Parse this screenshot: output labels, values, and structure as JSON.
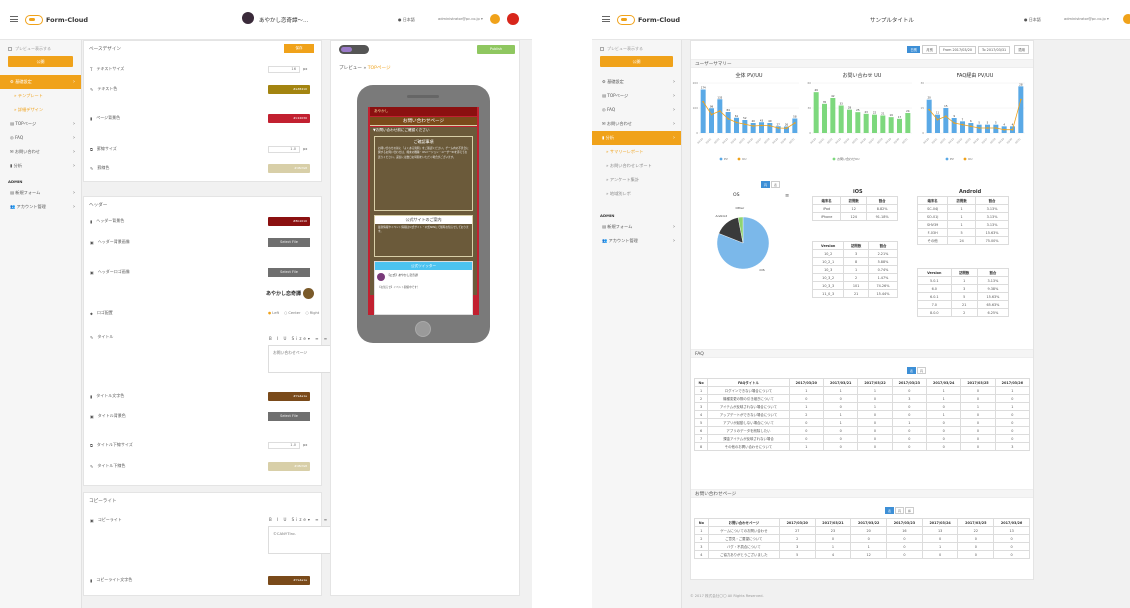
{
  "left": {
    "app_name": "Form-Cloud",
    "page_title": "あやかし恋奇譚〜…",
    "user_email": "administrator@pc.co.jp",
    "lang": "日本語",
    "sidebar": {
      "preview_label": "プレビュー表示する",
      "save_label": "公開",
      "items": [
        {
          "label": "基礎設定",
          "active": true
        },
        {
          "label": "テンプレート",
          "sub": true
        },
        {
          "label": "詳細デザイン",
          "sub": true,
          "current": true
        },
        {
          "label": "TOPページ"
        },
        {
          "label": "FAQ"
        },
        {
          "label": "お問い合わせ"
        },
        {
          "label": "分析"
        }
      ],
      "admin_heading": "ADMIN",
      "admin_items": [
        {
          "label": "新規フォーム"
        },
        {
          "label": "アカウント管理"
        }
      ]
    },
    "base_design": {
      "title": "ベースデザイン",
      "save_label": "保存",
      "fields": [
        {
          "label": "テキストサイズ",
          "value": "16",
          "unit": "px"
        },
        {
          "label": "テキスト色",
          "color": "#a38410",
          "hex": "#a38410"
        },
        {
          "label": "ページ背景色",
          "color": "#c22030",
          "hex": "#c22030"
        },
        {
          "label": "罫線サイズ",
          "value": "1.0",
          "unit": "px"
        },
        {
          "label": "罫線色",
          "color": "#d8cfa8",
          "hex": "#d8cfa8"
        }
      ]
    },
    "header": {
      "title": "ヘッダー",
      "bg_color_label": "ヘッダー背景色",
      "bg_color": "#8b1010",
      "bg_color_hex": "#8b1010",
      "bg_image_label": "ヘッダー背景画像",
      "bg_image_btn": "Select File",
      "logo_label": "ヘッダーロゴ画像",
      "logo_btn": "Select File",
      "logo_text": "あやかし恋奇譚",
      "align_label": "ロゴ配置",
      "align_opts": [
        "Left",
        "Center",
        "Right"
      ],
      "title_label": "タイトル",
      "title_value": "お問い合わせページ",
      "toolbar": "B  I  U  Size▾  ≡  ≡  ≡",
      "title_color_label": "タイトル文字色",
      "title_color": "#7a4a1a",
      "title_color_hex": "#7a4a1a",
      "title_bg_label": "タイトル背景色",
      "title_bg_btn": "Select File",
      "title_border_size_label": "タイトル下線サイズ",
      "title_border_size": "1.0",
      "title_border_color_label": "タイトル下線色",
      "title_border_color": "#d8cfa8",
      "title_border_color_hex": "#d8cfa8"
    },
    "copyright": {
      "title": "コピーライト",
      "label": "コピーライト",
      "value": "©CANYTInc.",
      "color_label": "コピーライト文字色",
      "color": "#7a4a1a",
      "color_hex": "#7a4a1a"
    },
    "preview": {
      "breadcrumb_root": "プレビュー",
      "breadcrumb_sep": "»",
      "breadcrumb_page": "TOPページ",
      "publish_btn": "Publish",
      "header_text": "あやかし",
      "page_title": "お問い合わせページ",
      "notice_heading": "▼お問い合わせ前にご確認ください",
      "box1_title": "ご確認事項",
      "box1_text": "お問い合わせの前に「よくある質問」をご確認ください。ゲーム内の不具合に関するお問い合わせは、端末の機種・OSバージョン・ユーザーIDを添えてお送りください。返信には数日お時間をいただく場合がございます。",
      "box2_title": "公式サイトのご案内",
      "box2_text": "最新情報やイベント情報は公式サイト・公式SNSにて随時お知らせしております。",
      "twitter_title": "公式ツイッター",
      "tweet_author": "【公式】あやかし恋奇譚",
      "tweet_text": "【お知らせ】イベント開催中です！"
    }
  },
  "right": {
    "app_name": "Form-Cloud",
    "page_title": "サンプルタイトル",
    "lang": "日本語",
    "user_email": "administrator@pc.co.jp",
    "sidebar": {
      "preview_label": "プレビュー表示する",
      "save_label": "公開",
      "items": [
        {
          "label": "基礎設定"
        },
        {
          "label": "TOPページ"
        },
        {
          "label": "FAQ"
        },
        {
          "label": "お問い合わせ"
        },
        {
          "label": "分析",
          "active": true
        },
        {
          "label": "サマリーレポート",
          "sub": true,
          "current": true
        },
        {
          "label": "お問い合わせレポート",
          "sub": true
        },
        {
          "label": "アンケート集計",
          "sub": true
        },
        {
          "label": "地域別レポ",
          "sub": true
        }
      ],
      "admin_heading": "ADMIN",
      "admin_items": [
        {
          "label": "新規フォーム"
        },
        {
          "label": "アカウント管理"
        }
      ]
    },
    "filter": {
      "tabs": [
        "日別",
        "月別"
      ],
      "from_label": "From",
      "from_value": "2017/03/20",
      "to_label": "To",
      "to_value": "2017/03/31",
      "apply": "適用"
    },
    "summary_title": "ユーザーサマリー",
    "charts": [
      {
        "title": "全体 PV/UU",
        "legend": [
          "PV",
          "UU"
        ],
        "bar_color": "#5aa9e6",
        "line_color": "#f0a21a"
      },
      {
        "title": "お問い合わせ UU",
        "legend": [
          "お問い合わせUU"
        ],
        "bar_color": "#7dd87d"
      },
      {
        "title": "FAQ経由 PV/UU",
        "legend": [
          "PV",
          "UU"
        ],
        "bar_color": "#5aa9e6",
        "line_color": "#f0a21a"
      }
    ],
    "chart_data": [
      {
        "type": "bar",
        "title": "全体 PV/UU",
        "categories": [
          "03/20",
          "03/21",
          "03/22",
          "03/23",
          "03/24",
          "03/25",
          "03/26",
          "03/27",
          "03/28",
          "03/29",
          "03/30",
          "03/31"
        ],
        "series": [
          {
            "name": "PV",
            "values": [
              174,
              99,
              135,
              84,
              61,
              52,
              40,
              43,
              40,
              27,
              26,
              58
            ]
          },
          {
            "name": "UU",
            "values": [
              125,
              74,
              88,
              57,
              42,
              35,
              28,
              30,
              29,
              20,
              19,
              40
            ]
          }
        ],
        "ylim": [
          0,
          200
        ]
      },
      {
        "type": "bar",
        "title": "お問い合わせ UU",
        "categories": [
          "03/20",
          "03/21",
          "03/22",
          "03/23",
          "03/24",
          "03/25",
          "03/26",
          "03/27",
          "03/28",
          "03/29",
          "03/30",
          "03/31"
        ],
        "series": [
          {
            "name": "お問い合わせUU",
            "values": [
              49,
              35,
              42,
              33,
              28,
              25,
              23,
              22,
              21,
              19,
              17,
              24
            ]
          }
        ],
        "ylim": [
          0,
          60
        ]
      },
      {
        "type": "bar",
        "title": "FAQ経由 PV/UU",
        "categories": [
          "03/20",
          "03/21",
          "03/22",
          "03/23",
          "03/24",
          "03/25",
          "03/26",
          "03/27",
          "03/28",
          "03/29",
          "03/30",
          "03/31"
        ],
        "series": [
          {
            "name": "PV",
            "values": [
              20,
              11,
              15,
              9,
              7,
              6,
              5,
              5,
              5,
              4,
              4,
              28
            ]
          },
          {
            "name": "UU",
            "values": [
              14,
              8,
              10,
              6,
              5,
              4,
              3,
              3,
              3,
              2,
              2,
              20
            ]
          }
        ],
        "ylim": [
          0,
          30
        ]
      },
      {
        "type": "pie",
        "title": "OS",
        "categories": [
          "iOS",
          "Android",
          "Other"
        ],
        "values": [
          81,
          16,
          3
        ]
      }
    ],
    "os_tabs": [
      "円",
      "表"
    ],
    "os_title": "OS",
    "ios": {
      "title": "iOS",
      "head": [
        "端末名",
        "訪問数",
        "割合"
      ],
      "rows": [
        [
          "iPad",
          "12",
          "8.82%"
        ],
        [
          "iPhone",
          "124",
          "91.18%"
        ]
      ],
      "ver_head": [
        "Version",
        "訪問数",
        "割合"
      ],
      "ver_rows": [
        [
          "10_2",
          "3",
          "2.21%"
        ],
        [
          "10_2_1",
          "8",
          "5.88%"
        ],
        [
          "10_3",
          "1",
          "0.74%"
        ],
        [
          "10_3_2",
          "2",
          "1.47%"
        ],
        [
          "10_3_3",
          "101",
          "74.26%"
        ],
        [
          "11_0_3",
          "21",
          "15.44%"
        ]
      ]
    },
    "android": {
      "title": "Android",
      "head": [
        "端末名",
        "訪問数",
        "割合"
      ],
      "rows": [
        [
          "SC-04J",
          "1",
          "3.13%"
        ],
        [
          "SO-01J",
          "1",
          "3.13%"
        ],
        [
          "SHV39",
          "1",
          "3.13%"
        ],
        [
          "F-03H",
          "5",
          "15.63%"
        ],
        [
          "その他",
          "24",
          "75.00%"
        ]
      ],
      "ver_head": [
        "Version",
        "訪問数",
        "割合"
      ],
      "ver_rows": [
        [
          "5.0.1",
          "1",
          "3.13%"
        ],
        [
          "6.0",
          "3",
          "9.38%"
        ],
        [
          "6.0.1",
          "5",
          "15.63%"
        ],
        [
          "7.0",
          "21",
          "65.63%"
        ],
        [
          "8.0.0",
          "2",
          "6.25%"
        ]
      ]
    },
    "faq": {
      "title": "FAQ",
      "tabs": [
        "表",
        "円"
      ],
      "head": [
        "No",
        "FAQタイトル",
        "2017/03/20",
        "2017/03/21",
        "2017/03/22",
        "2017/03/23",
        "2017/03/24",
        "2017/03/25",
        "2017/03/26"
      ],
      "rows": [
        [
          "1",
          "ログインできない場合について",
          "1",
          "1",
          "1",
          "0",
          "1",
          "0",
          "1"
        ],
        [
          "2",
          "機種変更の際の引き継ぎについて",
          "0",
          "0",
          "0",
          "3",
          "1",
          "0",
          "0"
        ],
        [
          "3",
          "アイテムが反映されない場合について",
          "1",
          "0",
          "1",
          "0",
          "0",
          "1",
          "1"
        ],
        [
          "4",
          "アップデートができない場合について",
          "2",
          "1",
          "0",
          "0",
          "1",
          "0",
          "0"
        ],
        [
          "5",
          "アプリが起動しない場合について",
          "0",
          "1",
          "0",
          "1",
          "0",
          "0",
          "0"
        ],
        [
          "6",
          "アプリのデータを削除したい",
          "0",
          "0",
          "0",
          "0",
          "0",
          "0",
          "0"
        ],
        [
          "7",
          "課金アイテムが反映されない場合",
          "0",
          "0",
          "0",
          "0",
          "0",
          "0",
          "0"
        ],
        [
          "8",
          "その他のお問い合わせについて",
          "1",
          "0",
          "0",
          "0",
          "0",
          "0",
          "3"
        ]
      ]
    },
    "inquiry": {
      "title": "お問い合わせページ",
      "tabs": [
        "表",
        "円",
        "棒"
      ],
      "head": [
        "No",
        "お問い合わせページ",
        "2017/03/20",
        "2017/03/21",
        "2017/03/22",
        "2017/03/23",
        "2017/03/24",
        "2017/03/25",
        "2017/03/26"
      ],
      "rows": [
        [
          "1",
          "ゲームについてのお問い合わせ",
          "27",
          "23",
          "20",
          "16",
          "13",
          "22",
          "13"
        ],
        [
          "2",
          "ご意見・ご要望について",
          "2",
          "0",
          "0",
          "0",
          "0",
          "0",
          "0"
        ],
        [
          "3",
          "バグ・不具合について",
          "3",
          "1",
          "1",
          "0",
          "1",
          "0",
          "0"
        ],
        [
          "4",
          "ご協力ありがとうございました",
          "5",
          "4",
          "12",
          "0",
          "0",
          "0",
          "0"
        ]
      ]
    },
    "footer": "© 2017 株式会社〇〇 All Rights Reserved."
  }
}
